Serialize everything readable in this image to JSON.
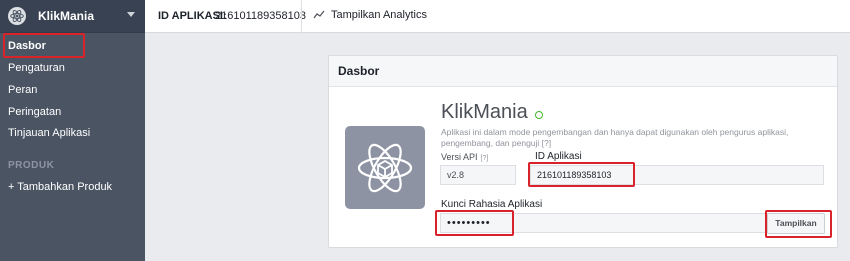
{
  "sidebar": {
    "app_name": "KlikMania",
    "items": [
      "Dasbor",
      "Pengaturan",
      "Peran",
      "Peringatan",
      "Tinjauan Aplikasi"
    ],
    "section_label": "PRODUK",
    "add_product": "+ Tambahkan Produk"
  },
  "topbar": {
    "id_label": "ID APLIKASI:",
    "id_value": "216101189358103",
    "analytics_link": "Tampilkan Analytics"
  },
  "panel": {
    "title": "Dasbor",
    "app_title": "KlikMania",
    "description": "Aplikasi ini dalam mode pengembangan dan hanya dapat digunakan oleh pengurus aplikasi, pengembang, dan penguji [?]",
    "api_version_label": "Versi API",
    "api_version_help": "[?]",
    "api_version_value": "v2.8",
    "app_id_label": "ID Aplikasi",
    "app_id_value": "216101189358103",
    "secret_label": "Kunci Rahasia Aplikasi",
    "secret_value": "•••••••••",
    "show_button": "Tampilkan"
  },
  "colors": {
    "sidebar_bg": "#4b5463",
    "highlight": "#d8232a",
    "status_green": "#42b72a"
  }
}
